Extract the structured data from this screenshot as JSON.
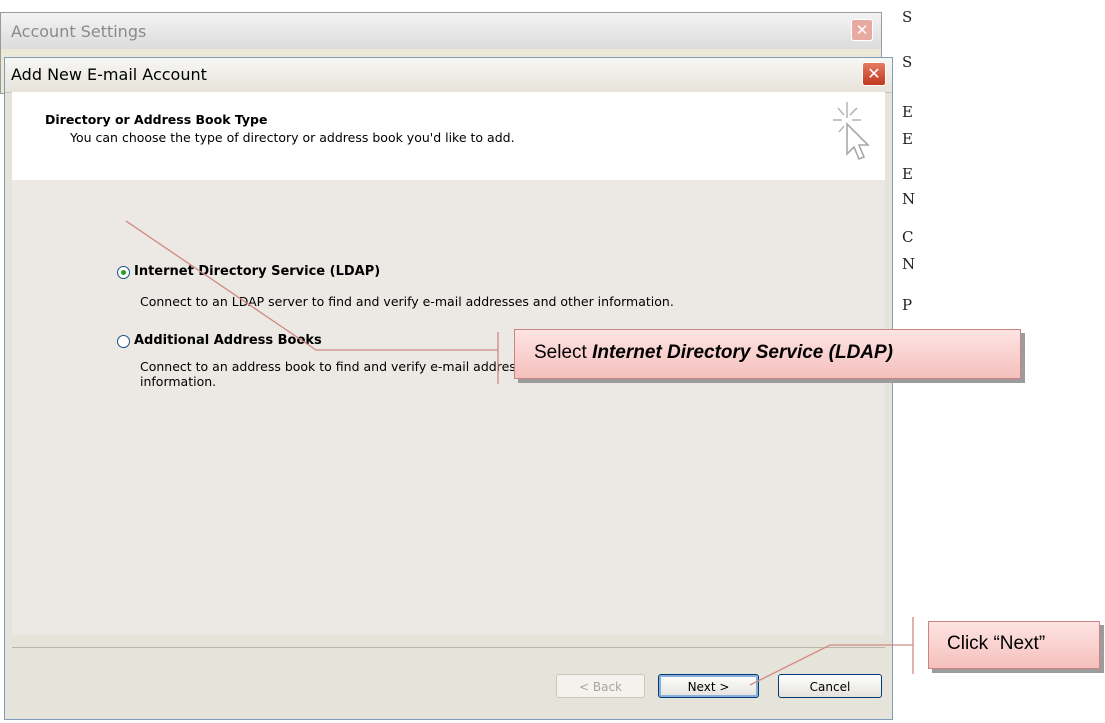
{
  "background_window": {
    "title": "Account Settings",
    "close_symbol": "✕"
  },
  "behind_text": [
    "S",
    "S",
    "E",
    "E",
    "E",
    "N",
    "C",
    "N",
    "P"
  ],
  "dialog": {
    "title": "Add New E-mail Account",
    "close_symbol": "✕",
    "header": {
      "title": "Directory or Address Book Type",
      "subtitle": "You can choose the type of directory or address book you'd like to add.",
      "icon": "cursor-sparkle-icon"
    },
    "options": [
      {
        "label": "Internet Directory Service (LDAP)",
        "description": "Connect to an LDAP server to find and verify e-mail addresses and other information.",
        "selected": true
      },
      {
        "label": "Additional Address Books",
        "description": "Connect to an address book to find and verify e-mail addresses and other information.",
        "selected": false
      }
    ],
    "buttons": {
      "back": "< Back",
      "next": "Next >",
      "cancel": "Cancel"
    }
  },
  "callouts": {
    "select": {
      "prefix": "Select ",
      "emphasis": "Internet Directory Service (LDAP)"
    },
    "next": {
      "text": "Click “Next”"
    }
  },
  "colors": {
    "callout_fill": "#f8d2cf",
    "callout_border": "#c98580",
    "dialog_bg": "#ece9e5",
    "close_red": "#c0381f"
  }
}
